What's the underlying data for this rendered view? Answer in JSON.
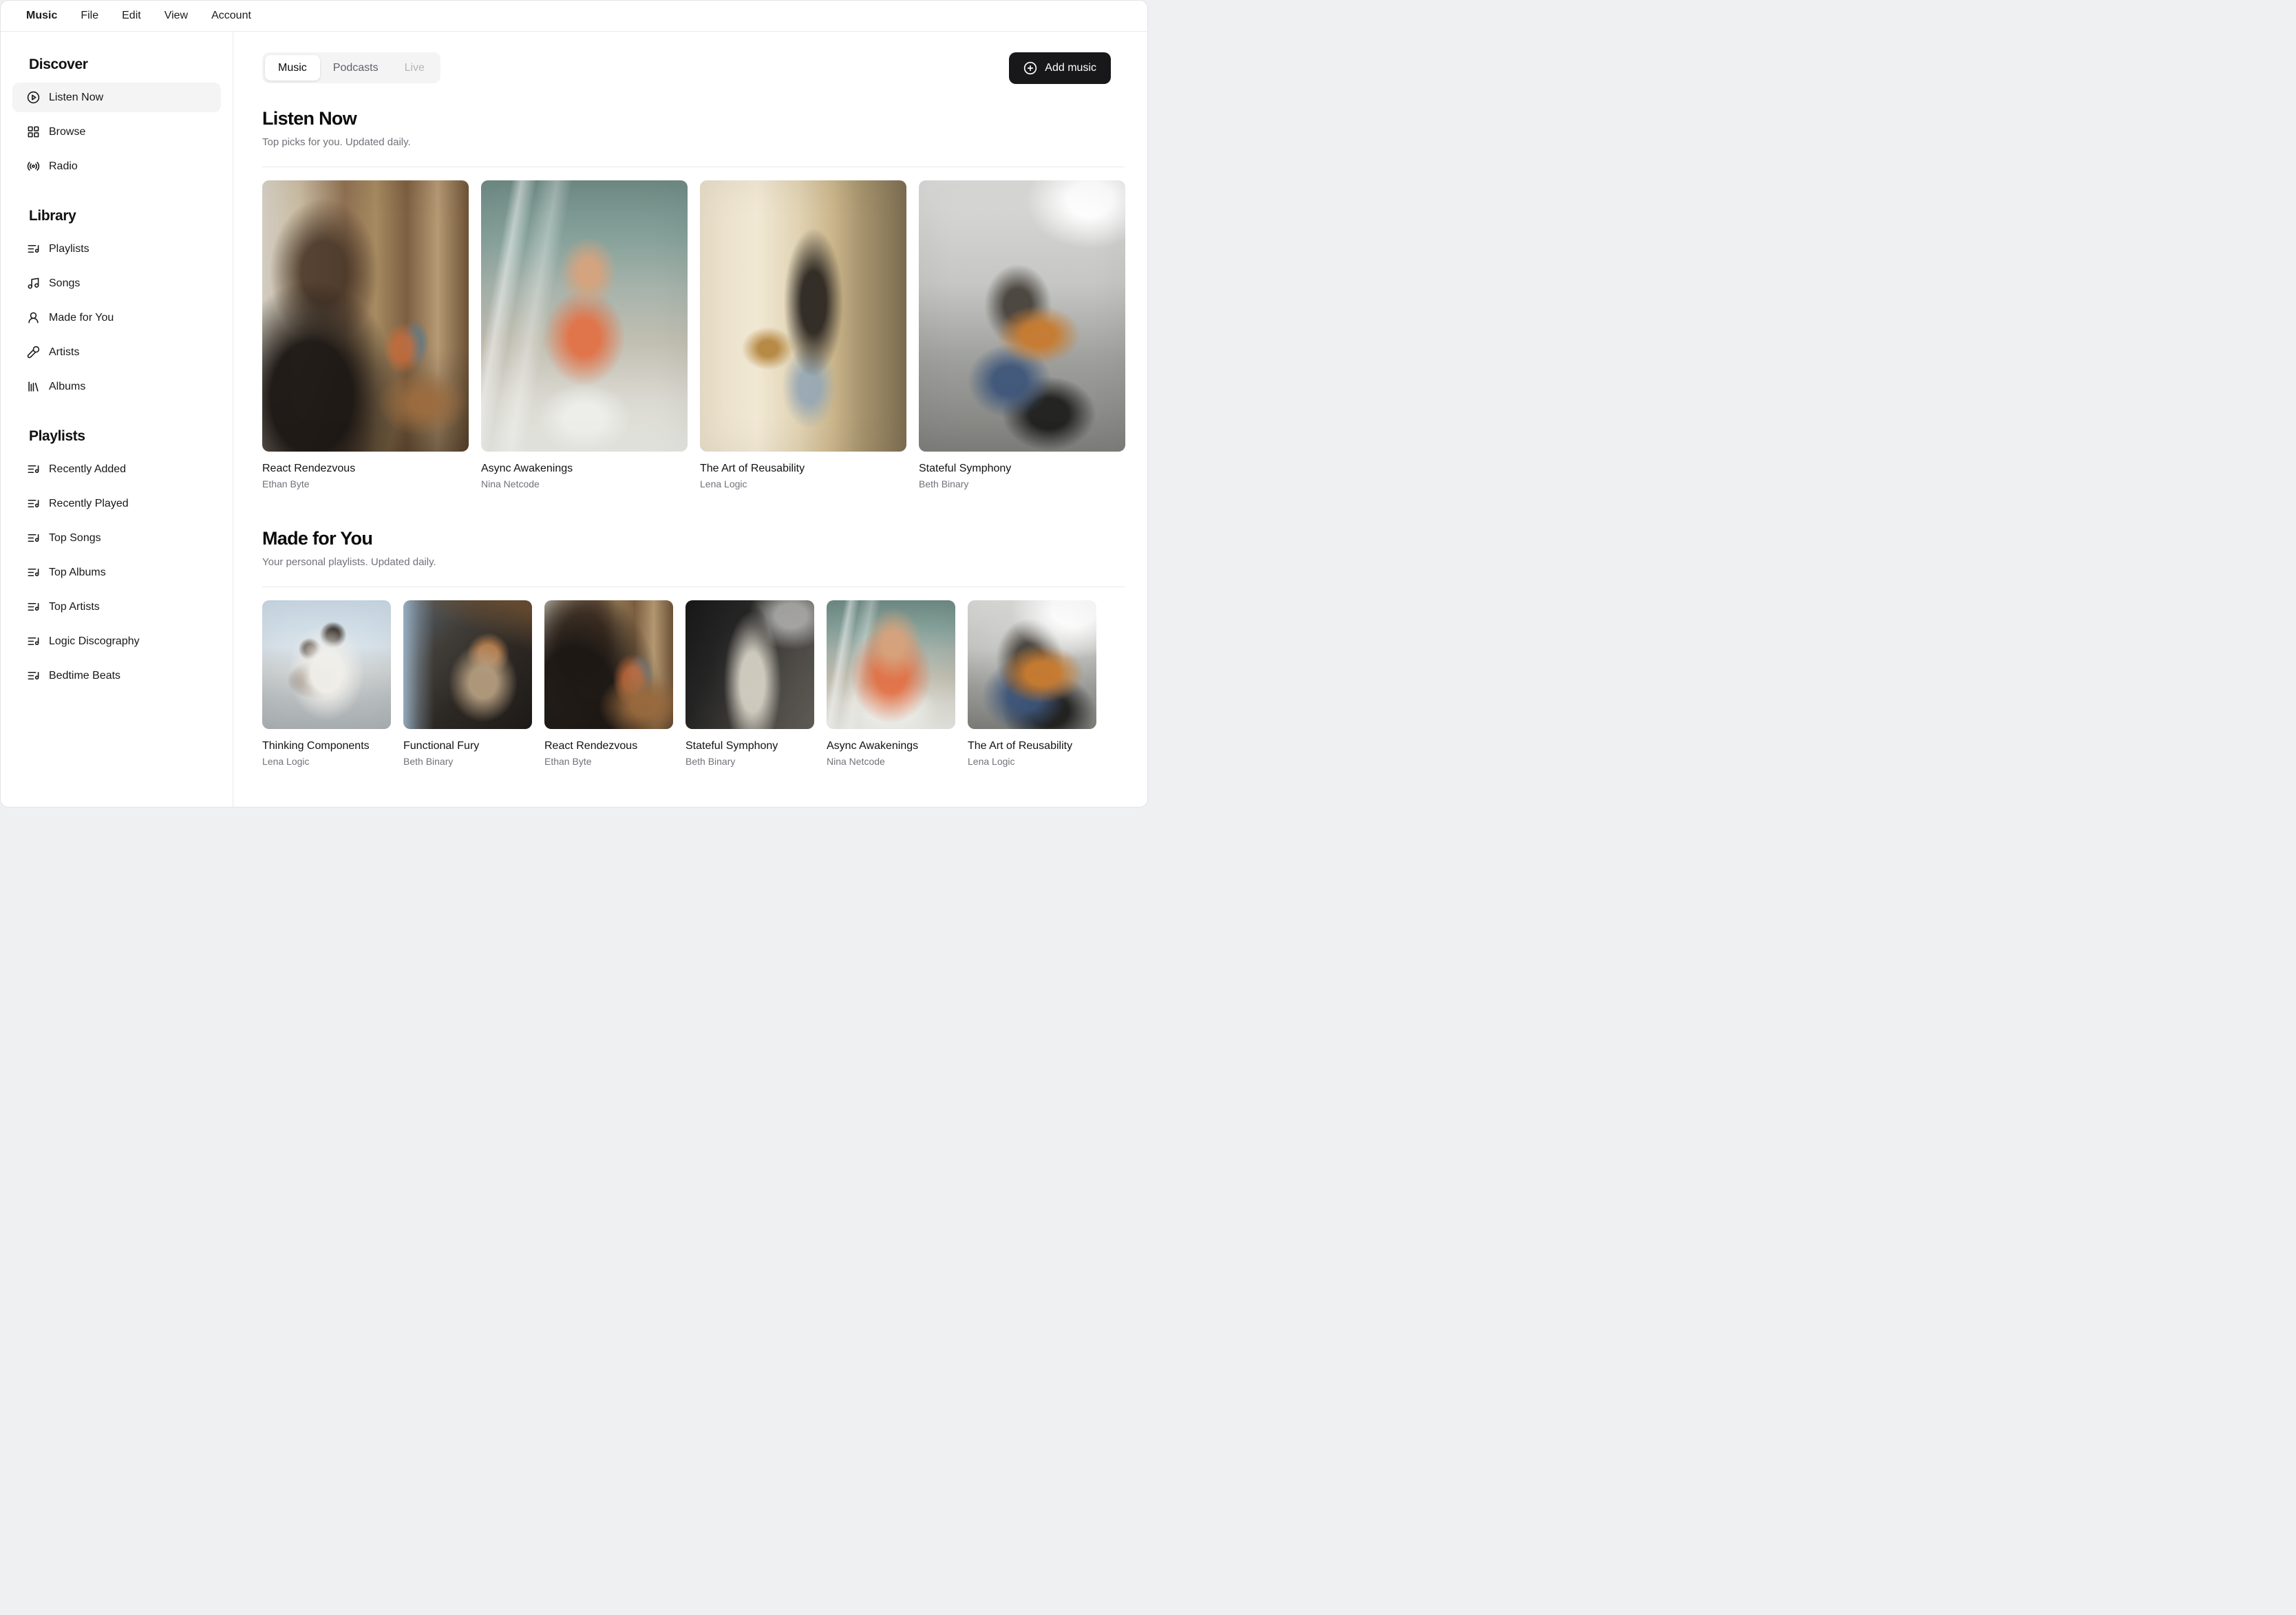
{
  "menubar": {
    "items": [
      {
        "label": "Music",
        "active": true
      },
      {
        "label": "File"
      },
      {
        "label": "Edit"
      },
      {
        "label": "View"
      },
      {
        "label": "Account"
      }
    ]
  },
  "sidebar": {
    "sections": [
      {
        "title": "Discover",
        "items": [
          {
            "label": "Listen Now",
            "icon": "play-circle-icon",
            "active": true
          },
          {
            "label": "Browse",
            "icon": "layout-grid-icon"
          },
          {
            "label": "Radio",
            "icon": "radio-icon"
          }
        ]
      },
      {
        "title": "Library",
        "items": [
          {
            "label": "Playlists",
            "icon": "list-music-icon"
          },
          {
            "label": "Songs",
            "icon": "music-note-icon"
          },
          {
            "label": "Made for You",
            "icon": "user-icon"
          },
          {
            "label": "Artists",
            "icon": "mic-icon"
          },
          {
            "label": "Albums",
            "icon": "library-icon"
          }
        ]
      },
      {
        "title": "Playlists",
        "items": [
          {
            "label": "Recently Added",
            "icon": "list-music-icon"
          },
          {
            "label": "Recently Played",
            "icon": "list-music-icon"
          },
          {
            "label": "Top Songs",
            "icon": "list-music-icon"
          },
          {
            "label": "Top Albums",
            "icon": "list-music-icon"
          },
          {
            "label": "Top Artists",
            "icon": "list-music-icon"
          },
          {
            "label": "Logic Discography",
            "icon": "list-music-icon"
          },
          {
            "label": "Bedtime Beats",
            "icon": "list-music-icon"
          }
        ]
      }
    ]
  },
  "main": {
    "tabs": [
      {
        "label": "Music",
        "state": "active"
      },
      {
        "label": "Podcasts",
        "state": "default"
      },
      {
        "label": "Live",
        "state": "disabled"
      }
    ],
    "add_music_label": "Add music",
    "sections": [
      {
        "title": "Listen Now",
        "subtitle": "Top picks for you. Updated daily.",
        "albums": [
          {
            "title": "React Rendezvous",
            "artist": "Ethan Byte",
            "art": "headphones-study"
          },
          {
            "title": "Async Awakenings",
            "artist": "Nina Netcode",
            "art": "window-reflection"
          },
          {
            "title": "The Art of Reusability",
            "artist": "Lena Logic",
            "art": "sax-street"
          },
          {
            "title": "Stateful Symphony",
            "artist": "Beth Binary",
            "art": "guitar-busker"
          }
        ]
      },
      {
        "title": "Made for You",
        "subtitle": "Your personal playlists. Updated daily.",
        "albums": [
          {
            "title": "Thinking Components",
            "artist": "Lena Logic",
            "art": "dock-duo"
          },
          {
            "title": "Functional Fury",
            "artist": "Beth Binary",
            "art": "piano-room"
          },
          {
            "title": "React Rendezvous",
            "artist": "Ethan Byte",
            "art": "headphones-study"
          },
          {
            "title": "Stateful Symphony",
            "artist": "Beth Binary",
            "art": "trumpet-bw"
          },
          {
            "title": "Async Awakenings",
            "artist": "Nina Netcode",
            "art": "window-reflection"
          },
          {
            "title": "The Art of Reusability",
            "artist": "Lena Logic",
            "art": "guitar-busker"
          }
        ]
      }
    ]
  },
  "colors": {
    "accent_dark": "#18181b",
    "muted_text": "#71717a",
    "border": "#e4e4e7",
    "active_bg": "#f4f4f5"
  }
}
